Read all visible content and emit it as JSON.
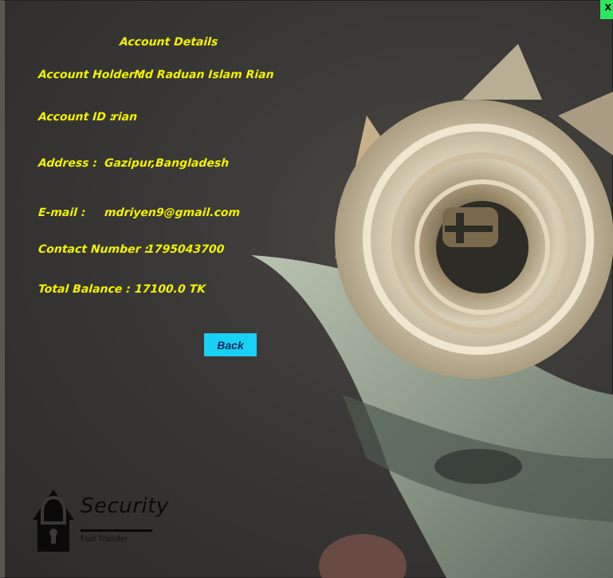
{
  "window": {
    "close_label": "X"
  },
  "details": {
    "heading": "Account Details",
    "holder_label": "Account Holder :",
    "holder_value": "Md Raduan Islam Rian",
    "id_label": "Account ID  :",
    "id_value": "rian",
    "address_label": "Address  :",
    "address_value": "Gazipur,Bangladesh",
    "email_label": "E-mail  :",
    "email_value": "mdriyen9@gmail.com",
    "contact_label": "Contact Number :",
    "contact_value": "1795043700",
    "balance_label": "Total Balance :",
    "balance_value": "17100.0 TK"
  },
  "actions": {
    "back_label": "Back"
  },
  "logo": {
    "title": "Security",
    "subtitle": "Fast Transfer"
  },
  "colors": {
    "text": "#f2f200",
    "button": "#19d0f5",
    "close": "#2ee65a"
  }
}
